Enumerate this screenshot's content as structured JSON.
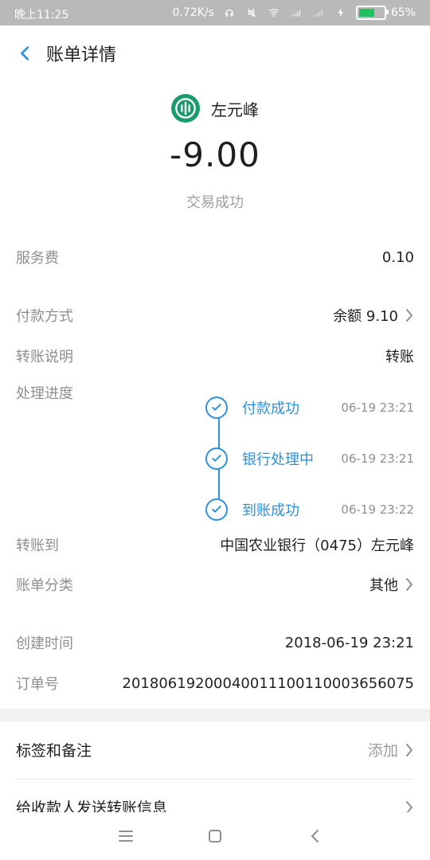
{
  "status_bar": {
    "time": "晚上11:25",
    "network_speed": "0.72K/s",
    "battery_percent": "65%",
    "battery_level": 0.65
  },
  "header": {
    "title": "账单详情"
  },
  "summary": {
    "payee_name": "左元峰",
    "amount": "-9.00",
    "status": "交易成功"
  },
  "rows": [
    {
      "label": "服务费",
      "value": "0.10"
    },
    {
      "label": "付款方式",
      "value": "余额 9.10"
    },
    {
      "label": "转账说明",
      "value": "转账"
    }
  ],
  "progress": {
    "label": "处理进度",
    "steps": [
      {
        "text": "付款成功",
        "time": "06-19 23:21"
      },
      {
        "text": "银行处理中",
        "time": "06-19 23:21"
      },
      {
        "text": "到账成功",
        "time": "06-19 23:22"
      }
    ]
  },
  "more_rows": [
    {
      "label": "转账到",
      "value": "中国农业银行（0475）左元峰"
    },
    {
      "label": "账单分类",
      "value": "其他"
    },
    {
      "label": "创建时间",
      "value": "2018-06-19 23:21"
    },
    {
      "label": "订单号",
      "value": "20180619200040011100110003656075"
    }
  ],
  "bottom": {
    "tags_notes": "标签和备注",
    "add": "添加",
    "send_info": "给收款人发送转账信息"
  },
  "colors": {
    "accent": "#2f91dd",
    "bank_logo": "#1a9b6d",
    "status_bar": "#b9b9b9"
  }
}
